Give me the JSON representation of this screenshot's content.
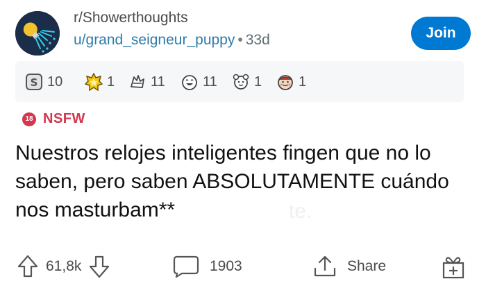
{
  "post": {
    "subreddit": "r/Showerthoughts",
    "username": "u/grand_seigneur_puppy",
    "separator": "•",
    "age": "33d",
    "join_label": "Join",
    "nsfw_badge": "18",
    "nsfw_label": "NSFW",
    "title": "Nuestros relojes inteligentes fingen que no lo saben, pero saben ABSOLUTAMENTE cuándo nos masturbam**",
    "ghost_text": "te."
  },
  "awards": [
    {
      "icon": "silver-award-icon",
      "count": "10"
    },
    {
      "icon": "gold-award-icon",
      "count": "1"
    },
    {
      "icon": "praise-award-icon",
      "count": "11"
    },
    {
      "icon": "laughing-award-icon",
      "count": "11"
    },
    {
      "icon": "wholesome-award-icon",
      "count": "1"
    },
    {
      "icon": "hugz-award-icon",
      "count": "1"
    }
  ],
  "actions": {
    "votes": "61,8k",
    "comments": "1903",
    "share_label": "Share"
  },
  "colors": {
    "join": "#0079d3",
    "nsfw": "#d4374e",
    "username": "#2e7ba8",
    "award_bar": "#f6f7f8"
  }
}
